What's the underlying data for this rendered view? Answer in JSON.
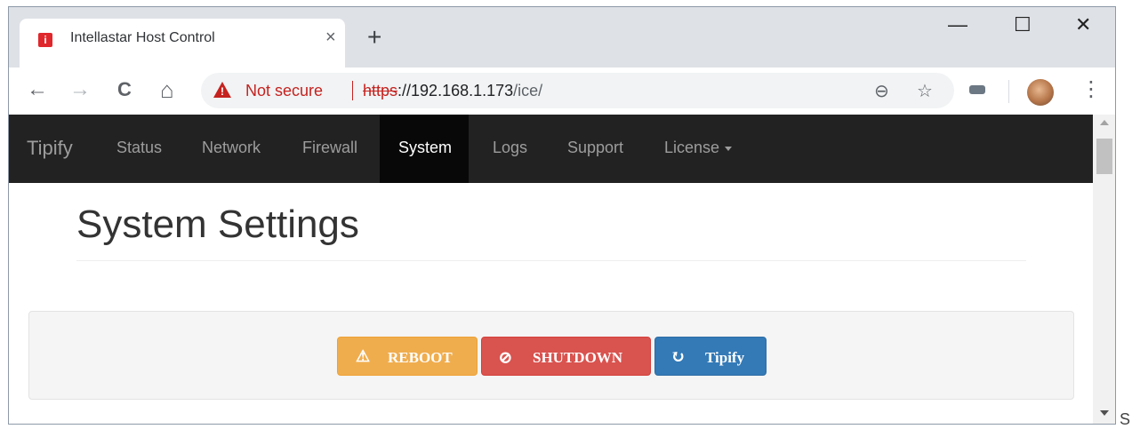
{
  "browser": {
    "tab": {
      "favicon": "i",
      "title": "Intellastar Host Control",
      "close": "×"
    },
    "new_tab": "+",
    "window_controls": {
      "minimize": "—",
      "maximize": "☐",
      "close": "✕"
    },
    "nav": {
      "back": "←",
      "forward": "→",
      "reload": "C",
      "home": "⌂"
    },
    "address": {
      "security_text": "Not secure",
      "scheme": "https",
      "host": "://192.168.1.173",
      "path": "/ice/"
    },
    "zoom_icon": "⊖",
    "bookmark_icon": "☆",
    "menu_icon": "⋮"
  },
  "navbar": {
    "brand": "Tipify",
    "items": [
      "Status",
      "Network",
      "Firewall",
      "System",
      "Logs",
      "Support",
      "License"
    ],
    "active": "System"
  },
  "page": {
    "title": "System Settings",
    "buttons": {
      "reboot": {
        "icon": "⚠",
        "label": "REBOOT"
      },
      "shutdown": {
        "icon": "⊘",
        "label": "SHUTDOWN"
      },
      "tipify": {
        "icon": "↻",
        "label": "Tipify"
      }
    }
  },
  "edge_text": "S",
  "colors": {
    "navbar_bg": "#222222",
    "reboot": "#f0ad4e",
    "shutdown": "#d9534f",
    "tipify": "#337ab7",
    "not_secure": "#c5221f"
  }
}
